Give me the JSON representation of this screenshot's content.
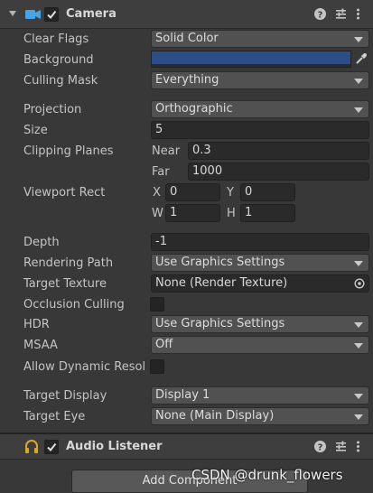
{
  "camera": {
    "title": "Camera",
    "fields": {
      "clear_flags": {
        "label": "Clear Flags",
        "value": "Solid Color"
      },
      "background": {
        "label": "Background",
        "color": "#2d4d86"
      },
      "culling_mask": {
        "label": "Culling Mask",
        "value": "Everything"
      },
      "projection": {
        "label": "Projection",
        "value": "Orthographic"
      },
      "size": {
        "label": "Size",
        "value": "5"
      },
      "clipping_planes": {
        "label": "Clipping Planes",
        "near_label": "Near",
        "near": "0.3",
        "far_label": "Far",
        "far": "1000"
      },
      "viewport_rect": {
        "label": "Viewport Rect",
        "x_label": "X",
        "x": "0",
        "y_label": "Y",
        "y": "0",
        "w_label": "W",
        "w": "1",
        "h_label": "H",
        "h": "1"
      },
      "depth": {
        "label": "Depth",
        "value": "-1"
      },
      "rendering_path": {
        "label": "Rendering Path",
        "value": "Use Graphics Settings"
      },
      "target_texture": {
        "label": "Target Texture",
        "value": "None (Render Texture)"
      },
      "occlusion_culling": {
        "label": "Occlusion Culling",
        "checked": false
      },
      "hdr": {
        "label": "HDR",
        "value": "Use Graphics Settings"
      },
      "msaa": {
        "label": "MSAA",
        "value": "Off"
      },
      "allow_dynamic_resolution": {
        "label": "Allow Dynamic Resol",
        "checked": false
      },
      "target_display": {
        "label": "Target Display",
        "value": "Display 1"
      },
      "target_eye": {
        "label": "Target Eye",
        "value": "None (Main Display)"
      }
    }
  },
  "audio_listener": {
    "title": "Audio Listener"
  },
  "footer": {
    "add_component": "Add Component",
    "watermark": "CSDN @drunk_flowers"
  },
  "colors": {
    "accent_camera": "#4aa3e6",
    "accent_audio": "#e0a520"
  }
}
